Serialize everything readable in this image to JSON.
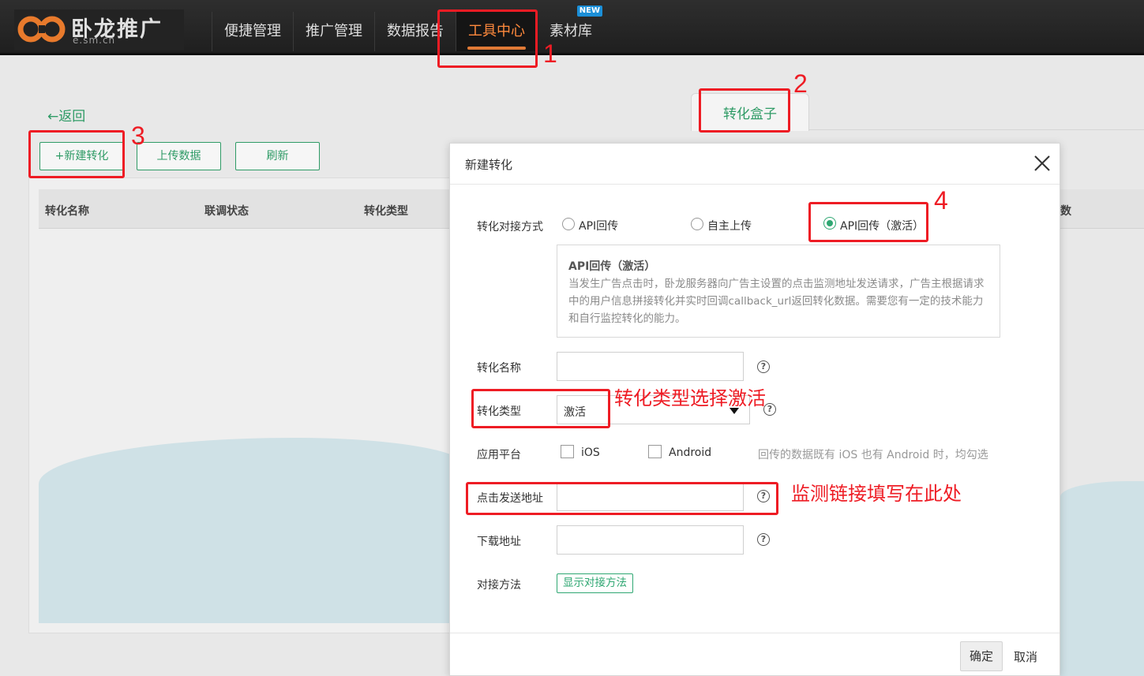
{
  "brand": {
    "name": "卧龙推广",
    "domain": "e.sm.cn"
  },
  "nav": {
    "items": [
      {
        "label": "便捷管理"
      },
      {
        "label": "推广管理"
      },
      {
        "label": "数据报告"
      },
      {
        "label": "工具中心"
      },
      {
        "label": "素材库"
      }
    ],
    "new_badge": "NEW",
    "active": "工具中心"
  },
  "page": {
    "back_arrow": "←",
    "back_label": "返回",
    "tab_label": "转化盒子",
    "buttons": {
      "new": "+新建转化",
      "upload": "上传数据",
      "refresh": "刷新"
    },
    "columns": [
      "转化名称",
      "联调状态",
      "转化类型"
    ],
    "partial_column": "数"
  },
  "modal": {
    "title": "新建转化",
    "close_icon": "close-icon",
    "fields": {
      "method": {
        "label": "转化对接方式",
        "options": [
          "API回传",
          "自主上传",
          "API回传（激活）"
        ],
        "selected": "API回传（激活）"
      },
      "description": {
        "title": "API回传（激活）",
        "text": "当发生广告点击时，卧龙服务器向广告主设置的点击监测地址发送请求，广告主根据请求中的用户信息拼接转化并实时回调callback_url返回转化数据。需要您有一定的技术能力和自行监控转化的能力。"
      },
      "name": {
        "label": "转化名称",
        "value": ""
      },
      "type": {
        "label": "转化类型",
        "value": "激活"
      },
      "platform": {
        "label": "应用平台",
        "options": [
          "iOS",
          "Android"
        ],
        "hint": "回传的数据既有 iOS 也有 Android 时，均勾选"
      },
      "click_url": {
        "label": "点击发送地址",
        "value": ""
      },
      "download_url": {
        "label": "下载地址",
        "value": ""
      },
      "integration": {
        "label": "对接方法",
        "button": "显示对接方法"
      }
    },
    "footer": {
      "ok": "确定",
      "cancel": "取消"
    },
    "help_glyph": "?"
  },
  "annotations": {
    "color": "#ee1c24",
    "numbers": [
      "1",
      "2",
      "3",
      "4"
    ],
    "note_type": "转化类型选择激活",
    "note_url": "监测链接填写在此处"
  }
}
